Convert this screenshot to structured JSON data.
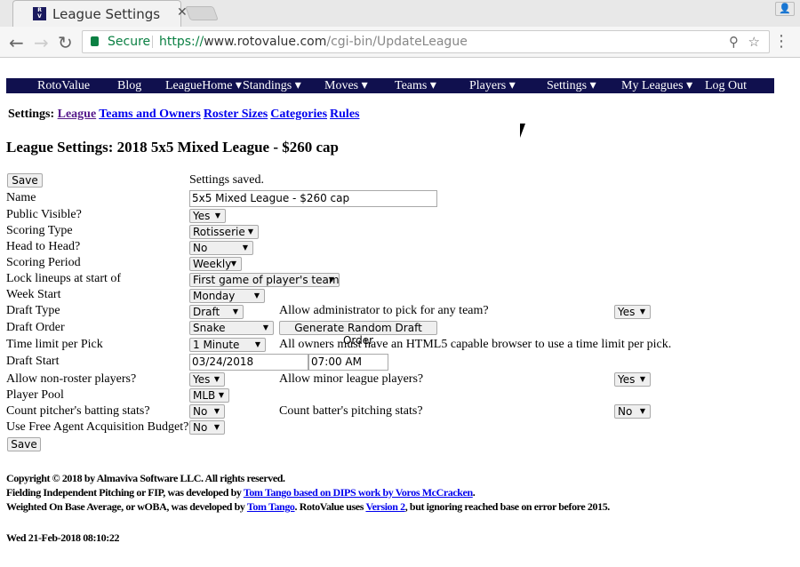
{
  "browser": {
    "tab_title": "League Settings: 2018 5x5 Mixed League - $260 cap",
    "favicon_text": "RV",
    "secure_label": "Secure",
    "url_scheme": "https://",
    "url_host": "www.rotovalue.com",
    "url_path": "/cgi-bin/UpdateLeague"
  },
  "navbar": {
    "items": [
      "RotoValue",
      "Blog",
      "LeagueHome ▾",
      "Standings ▾",
      "Moves ▾",
      "Teams ▾",
      "Players ▾",
      "Settings ▾",
      "My Leagues ▾",
      "Log Out"
    ]
  },
  "subnav": {
    "prefix": "Settings:",
    "links": [
      "League",
      "Teams and Owners",
      "Roster Sizes",
      "Categories",
      "Rules"
    ]
  },
  "page_title": "League Settings: 2018 5x5 Mixed League - $260 cap",
  "form": {
    "save_label": "Save",
    "status": "Settings saved.",
    "name_label": "Name",
    "name_value": "5x5 Mixed League - $260 cap",
    "public_label": "Public Visible?",
    "public_value": "Yes",
    "scoring_type_label": "Scoring Type",
    "scoring_type_value": "Rotisserie",
    "h2h_label": "Head to Head?",
    "h2h_value": "No",
    "period_label": "Scoring Period",
    "period_value": "Weekly",
    "lock_label": "Lock lineups at start of",
    "lock_value": "First game of player's team",
    "week_start_label": "Week Start",
    "week_start_value": "Monday",
    "draft_type_label": "Draft Type",
    "draft_type_value": "Draft",
    "admin_pick_label": "Allow administrator to pick for any team?",
    "admin_pick_value": "Yes",
    "draft_order_label": "Draft Order",
    "draft_order_value": "Snake",
    "random_order_button": "Generate Random Draft Order",
    "time_limit_label": "Time limit per Pick",
    "time_limit_value": "1 Minute",
    "time_limit_note": "All owners must have an HTML5 capable browser to use a time limit per pick.",
    "draft_start_label": "Draft Start",
    "draft_start_date": "03/24/2018",
    "draft_start_time": "07:00 AM",
    "non_roster_label": "Allow non-roster players?",
    "non_roster_value": "Yes",
    "minor_label": "Allow minor league players?",
    "minor_value": "Yes",
    "pool_label": "Player Pool",
    "pool_value": "MLB",
    "pitcher_batting_label": "Count pitcher's batting stats?",
    "pitcher_batting_value": "No",
    "batter_pitching_label": "Count batter's pitching stats?",
    "batter_pitching_value": "No",
    "faab_label": "Use Free Agent Acquisition Budget?",
    "faab_value": "No"
  },
  "footer": {
    "copyright": "Copyright © 2018 by Almaviva Software LLC. All rights reserved.",
    "fip_text": "Fielding Independent Pitching or FIP, was developed by ",
    "fip_link": "Tom Tango based on DIPS work by Voros McCracken",
    "fip_end": ".",
    "woba_text": "Weighted On Base Average, or wOBA, was developed by ",
    "woba_link": "Tom Tango",
    "woba_mid": ". RotoValue uses ",
    "woba_link2": "Version 2",
    "woba_end": ", but ignoring reached base on error before 2015.",
    "timestamp": "Wed 21-Feb-2018 08:10:22"
  }
}
